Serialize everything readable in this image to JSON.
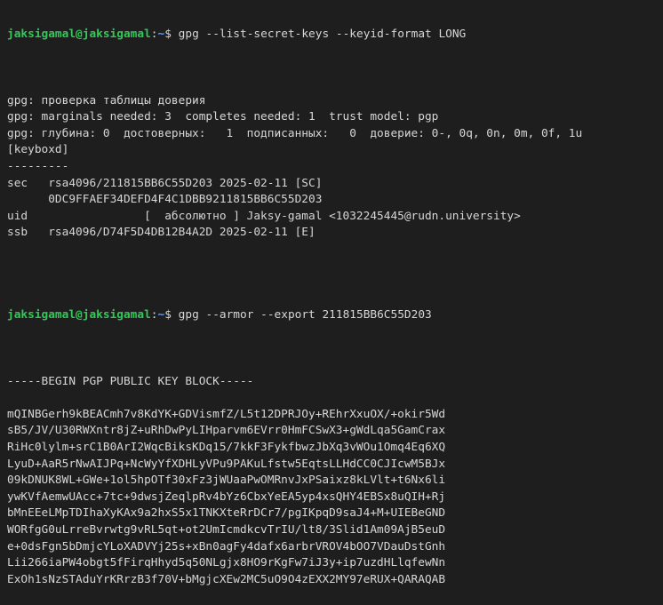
{
  "prompt": {
    "user_host": "jaksigamal@jaksigamal",
    "sep": ":",
    "path": "~",
    "symbol": "$"
  },
  "commands": {
    "first": "gpg --list-secret-keys --keyid-format LONG",
    "second": "gpg --armor --export 211815BB6C55D203"
  },
  "output1": [
    "gpg: проверка таблицы доверия",
    "gpg: marginals needed: 3  completes needed: 1  trust model: pgp",
    "gpg: глубина: 0  достоверных:   1  подписанных:   0  доверие: 0-, 0q, 0n, 0m, 0f, 1u",
    "[keyboxd]",
    "---------",
    "sec   rsa4096/211815BB6C55D203 2025-02-11 [SC]",
    "      0DC9FFAEF34DEFD4F4C1DBB9211815BB6C55D203",
    "uid                 [  абсолютно ] Jaksy-gamal <1032245445@rudn.university>",
    "ssb   rsa4096/D74F5D4DB12B4A2D 2025-02-11 [E]",
    ""
  ],
  "output2": [
    "-----BEGIN PGP PUBLIC KEY BLOCK-----",
    "",
    "mQINBGerh9kBEACmh7v8KdYK+GDVismfZ/L5t12DPRJOy+REhrXxuOX/+okir5Wd",
    "sB5/JV/U30RWXntr8jZ+uRhDwPyLIHparvm6EVrr0HmFCSwX3+gWdLqa5GamCrax",
    "RiHc0lylm+srC1B0ArI2WqcBiksKDq15/7kkF3FykfbwzJbXq3vWOu1Omq4Eq6XQ",
    "LyuD+AaR5rNwAIJPq+NcWyYfXDHLyVPu9PAKuLfstw5EqtsLLHdCC0CJIcwM5BJx",
    "09kDNUK8WL+GWe+1ol5hpOTf30xFz3jWUaaPwOMRnvJxPSaixz8kLVlt+t6Nx6li",
    "ywKVfAemwUAcc+7tc+9dwsjZeqlpRv4bYz6CbxYeEA5yp4xsQHY4EBSx8uQIH+Rj",
    "bMnEEeLMpTDIhaXyKAx9a2hxS5x1TNKXteRrDCr7/pgIKpqD9saJ4+M+UIEBeGND",
    "WORfgG0uLrreBvrwtg9vRL5qt+ot2UmIcmdkcvTrIU/lt8/3Slid1Am09AjB5euD",
    "e+0dsFgn5bDmjcYLoXADVYj25s+xBn0agFy4dafx6arbrVROV4bOO7VDauDstGnh",
    "Lii266iaPW4obgt5fFirqHhyd5q50NLgjx8HO9rKgFw7iJ3y+ip7uzdHLlqfewNn",
    "ExOh1sNzSTAduYrKRrzB3f70V+bMgjcXEw2MC5uO9O4zEXX2MY97eRUX+QARAQAB"
  ]
}
